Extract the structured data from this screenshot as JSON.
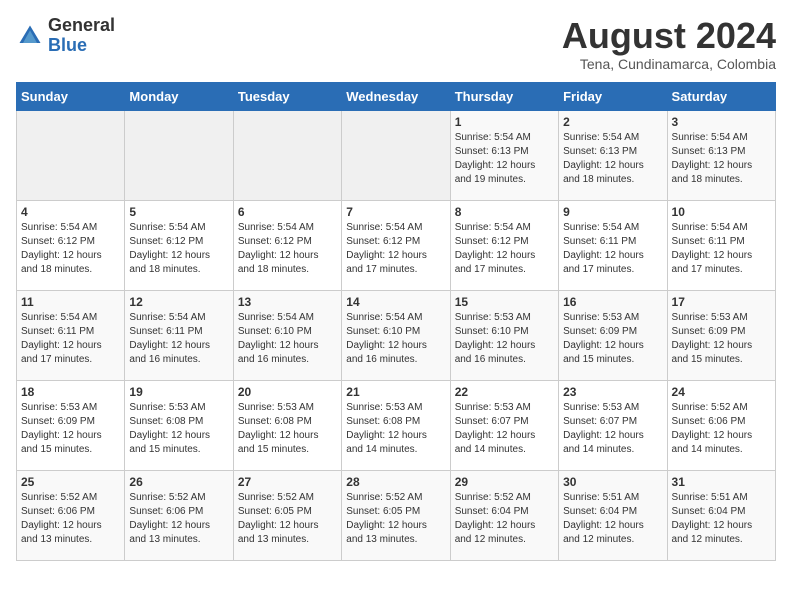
{
  "logo": {
    "general": "General",
    "blue": "Blue"
  },
  "title": "August 2024",
  "subtitle": "Tena, Cundinamarca, Colombia",
  "days_of_week": [
    "Sunday",
    "Monday",
    "Tuesday",
    "Wednesday",
    "Thursday",
    "Friday",
    "Saturday"
  ],
  "weeks": [
    [
      {
        "day": "",
        "info": ""
      },
      {
        "day": "",
        "info": ""
      },
      {
        "day": "",
        "info": ""
      },
      {
        "day": "",
        "info": ""
      },
      {
        "day": "1",
        "info": "Sunrise: 5:54 AM\nSunset: 6:13 PM\nDaylight: 12 hours\nand 19 minutes."
      },
      {
        "day": "2",
        "info": "Sunrise: 5:54 AM\nSunset: 6:13 PM\nDaylight: 12 hours\nand 18 minutes."
      },
      {
        "day": "3",
        "info": "Sunrise: 5:54 AM\nSunset: 6:13 PM\nDaylight: 12 hours\nand 18 minutes."
      }
    ],
    [
      {
        "day": "4",
        "info": "Sunrise: 5:54 AM\nSunset: 6:12 PM\nDaylight: 12 hours\nand 18 minutes."
      },
      {
        "day": "5",
        "info": "Sunrise: 5:54 AM\nSunset: 6:12 PM\nDaylight: 12 hours\nand 18 minutes."
      },
      {
        "day": "6",
        "info": "Sunrise: 5:54 AM\nSunset: 6:12 PM\nDaylight: 12 hours\nand 18 minutes."
      },
      {
        "day": "7",
        "info": "Sunrise: 5:54 AM\nSunset: 6:12 PM\nDaylight: 12 hours\nand 17 minutes."
      },
      {
        "day": "8",
        "info": "Sunrise: 5:54 AM\nSunset: 6:12 PM\nDaylight: 12 hours\nand 17 minutes."
      },
      {
        "day": "9",
        "info": "Sunrise: 5:54 AM\nSunset: 6:11 PM\nDaylight: 12 hours\nand 17 minutes."
      },
      {
        "day": "10",
        "info": "Sunrise: 5:54 AM\nSunset: 6:11 PM\nDaylight: 12 hours\nand 17 minutes."
      }
    ],
    [
      {
        "day": "11",
        "info": "Sunrise: 5:54 AM\nSunset: 6:11 PM\nDaylight: 12 hours\nand 17 minutes."
      },
      {
        "day": "12",
        "info": "Sunrise: 5:54 AM\nSunset: 6:11 PM\nDaylight: 12 hours\nand 16 minutes."
      },
      {
        "day": "13",
        "info": "Sunrise: 5:54 AM\nSunset: 6:10 PM\nDaylight: 12 hours\nand 16 minutes."
      },
      {
        "day": "14",
        "info": "Sunrise: 5:54 AM\nSunset: 6:10 PM\nDaylight: 12 hours\nand 16 minutes."
      },
      {
        "day": "15",
        "info": "Sunrise: 5:53 AM\nSunset: 6:10 PM\nDaylight: 12 hours\nand 16 minutes."
      },
      {
        "day": "16",
        "info": "Sunrise: 5:53 AM\nSunset: 6:09 PM\nDaylight: 12 hours\nand 15 minutes."
      },
      {
        "day": "17",
        "info": "Sunrise: 5:53 AM\nSunset: 6:09 PM\nDaylight: 12 hours\nand 15 minutes."
      }
    ],
    [
      {
        "day": "18",
        "info": "Sunrise: 5:53 AM\nSunset: 6:09 PM\nDaylight: 12 hours\nand 15 minutes."
      },
      {
        "day": "19",
        "info": "Sunrise: 5:53 AM\nSunset: 6:08 PM\nDaylight: 12 hours\nand 15 minutes."
      },
      {
        "day": "20",
        "info": "Sunrise: 5:53 AM\nSunset: 6:08 PM\nDaylight: 12 hours\nand 15 minutes."
      },
      {
        "day": "21",
        "info": "Sunrise: 5:53 AM\nSunset: 6:08 PM\nDaylight: 12 hours\nand 14 minutes."
      },
      {
        "day": "22",
        "info": "Sunrise: 5:53 AM\nSunset: 6:07 PM\nDaylight: 12 hours\nand 14 minutes."
      },
      {
        "day": "23",
        "info": "Sunrise: 5:53 AM\nSunset: 6:07 PM\nDaylight: 12 hours\nand 14 minutes."
      },
      {
        "day": "24",
        "info": "Sunrise: 5:52 AM\nSunset: 6:06 PM\nDaylight: 12 hours\nand 14 minutes."
      }
    ],
    [
      {
        "day": "25",
        "info": "Sunrise: 5:52 AM\nSunset: 6:06 PM\nDaylight: 12 hours\nand 13 minutes."
      },
      {
        "day": "26",
        "info": "Sunrise: 5:52 AM\nSunset: 6:06 PM\nDaylight: 12 hours\nand 13 minutes."
      },
      {
        "day": "27",
        "info": "Sunrise: 5:52 AM\nSunset: 6:05 PM\nDaylight: 12 hours\nand 13 minutes."
      },
      {
        "day": "28",
        "info": "Sunrise: 5:52 AM\nSunset: 6:05 PM\nDaylight: 12 hours\nand 13 minutes."
      },
      {
        "day": "29",
        "info": "Sunrise: 5:52 AM\nSunset: 6:04 PM\nDaylight: 12 hours\nand 12 minutes."
      },
      {
        "day": "30",
        "info": "Sunrise: 5:51 AM\nSunset: 6:04 PM\nDaylight: 12 hours\nand 12 minutes."
      },
      {
        "day": "31",
        "info": "Sunrise: 5:51 AM\nSunset: 6:04 PM\nDaylight: 12 hours\nand 12 minutes."
      }
    ]
  ]
}
